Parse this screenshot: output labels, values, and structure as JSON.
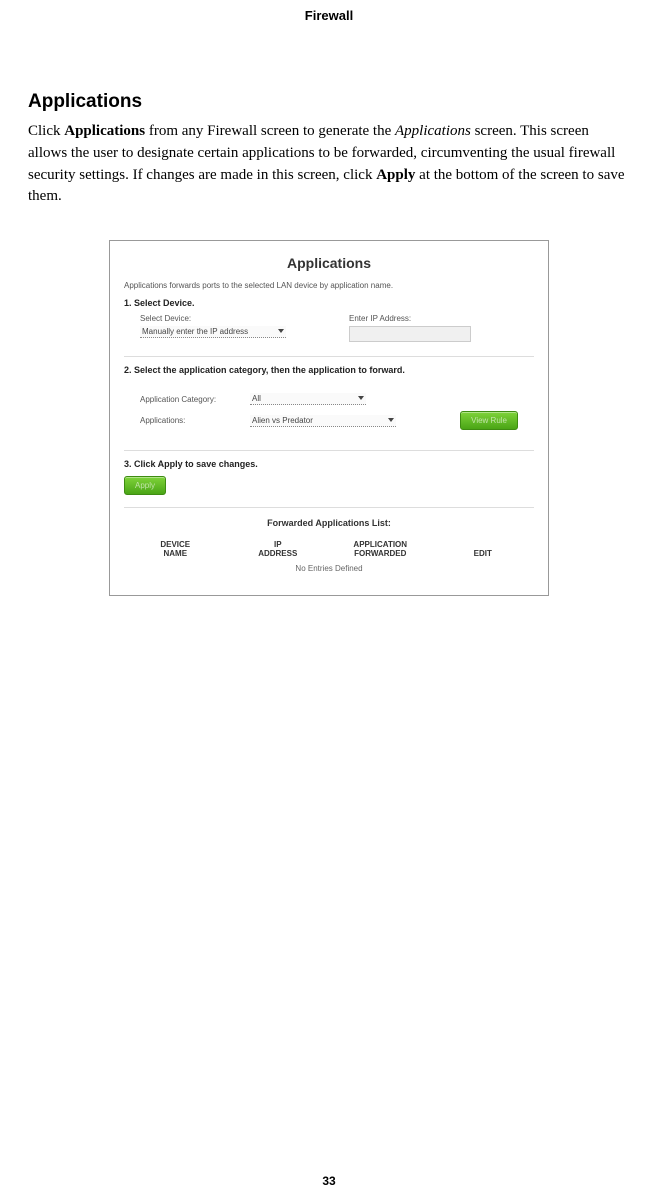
{
  "page": {
    "number": "33"
  },
  "header": {
    "title": "Firewall"
  },
  "section": {
    "heading": "Applications",
    "para_pre": "Click ",
    "para_link1": "Applications",
    "para_mid1": " from any Firewall screen to generate the ",
    "para_em": "Applications",
    "para_mid2": " screen. This screen allows the user to designate certain applications to be forwarded, circumventing the usual firewall security settings. If changes are made in this screen, click ",
    "para_link2": "Apply",
    "para_post": " at the bottom of the screen to save them."
  },
  "screenshot": {
    "title": "Applications",
    "subtitle": "Applications forwards ports to the selected LAN device by application name.",
    "step1": "1. Select Device.",
    "select_device_label": "Select Device:",
    "select_device_value": "Manually enter the IP address",
    "enter_ip_label": "Enter IP Address:",
    "step2": "2. Select the application category, then the application to forward.",
    "app_cat_label": "Application Category:",
    "app_cat_value": "All",
    "apps_label": "Applications:",
    "apps_value": "Alien vs Predator",
    "view_rule_button": "View Rule",
    "step3": "3. Click Apply to save changes.",
    "apply_button": "Apply",
    "forwarded_list_title": "Forwarded Applications List:",
    "thead": {
      "c1a": "DEVICE",
      "c1b": "NAME",
      "c2a": "IP",
      "c2b": "ADDRESS",
      "c3a": "APPLICATION",
      "c3b": "FORWARDED",
      "c4": "EDIT"
    },
    "no_entries": "No Entries Defined"
  }
}
